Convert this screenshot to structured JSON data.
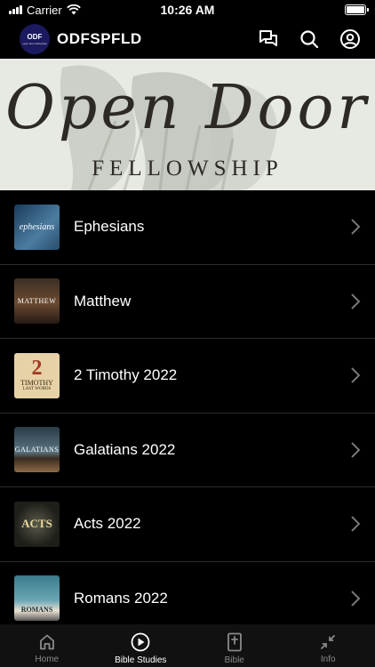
{
  "status": {
    "carrier": "Carrier",
    "time": "10:26 AM"
  },
  "header": {
    "logo_text": "ODF",
    "logo_subtext": "open door fellowship",
    "title": "ODFSPFLD"
  },
  "banner": {
    "title": "Open Door",
    "subtitle": "FELLOWSHIP"
  },
  "studies": [
    {
      "label": "Ephesians",
      "thumb_text": "ephesians"
    },
    {
      "label": "Matthew",
      "thumb_text": "MATTHEW"
    },
    {
      "label": "2 Timothy 2022",
      "thumb_text": "TIMOTHY",
      "thumb_num": "2",
      "thumb_sub": "LAST WORDS"
    },
    {
      "label": "Galatians 2022",
      "thumb_text": "GALATIANS"
    },
    {
      "label": "Acts 2022",
      "thumb_text": "ACTS"
    },
    {
      "label": "Romans 2022",
      "thumb_text": "ROMANS"
    }
  ],
  "tabs": [
    {
      "label": "Home"
    },
    {
      "label": "Bible Studies",
      "active": true
    },
    {
      "label": "Bible"
    },
    {
      "label": "Info"
    }
  ]
}
